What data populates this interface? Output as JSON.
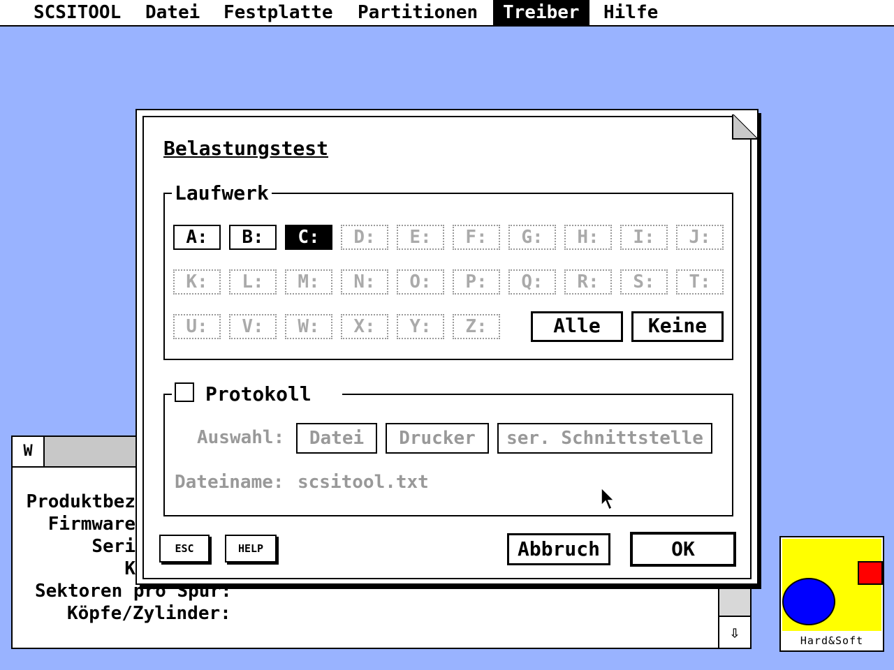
{
  "menubar": {
    "app": "SCSITOOL",
    "items": [
      "Datei",
      "Festplatte",
      "Partitionen",
      "Treiber",
      "Hilfe"
    ],
    "active": "Treiber"
  },
  "background_window": {
    "close_glyph": "W",
    "labels": [
      "Produktbez",
      "Firmware",
      "Seri",
      "K",
      "Sektoren pro Spur:",
      "Köpfe/Zylinder:"
    ],
    "scroll_down_glyph": "⇩"
  },
  "logo": {
    "text": "Hard&Soft"
  },
  "dialog": {
    "title": "Belastungstest",
    "drive_group_label": "Laufwerk",
    "drives": [
      "A:",
      "B:",
      "C:",
      "D:",
      "E:",
      "F:",
      "G:",
      "H:",
      "I:",
      "J:",
      "K:",
      "L:",
      "M:",
      "N:",
      "O:",
      "P:",
      "Q:",
      "R:",
      "S:",
      "T:",
      "U:",
      "V:",
      "W:",
      "X:",
      "Y:",
      "Z:"
    ],
    "enabled_drives": [
      "A:",
      "B:"
    ],
    "selected_drive": "C:",
    "all_label": "Alle",
    "none_label": "Keine",
    "protocol_label": "Protokoll",
    "protocol_checked": false,
    "selection_label": "Auswahl:",
    "output_options": [
      "Datei",
      "Drucker",
      "ser. Schnittstelle"
    ],
    "filename_label": "Dateiname:",
    "filename_value": "scsitool.txt",
    "esc_label": "ESC",
    "help_label": "HELP",
    "cancel_label": "Abbruch",
    "ok_label": "OK"
  }
}
